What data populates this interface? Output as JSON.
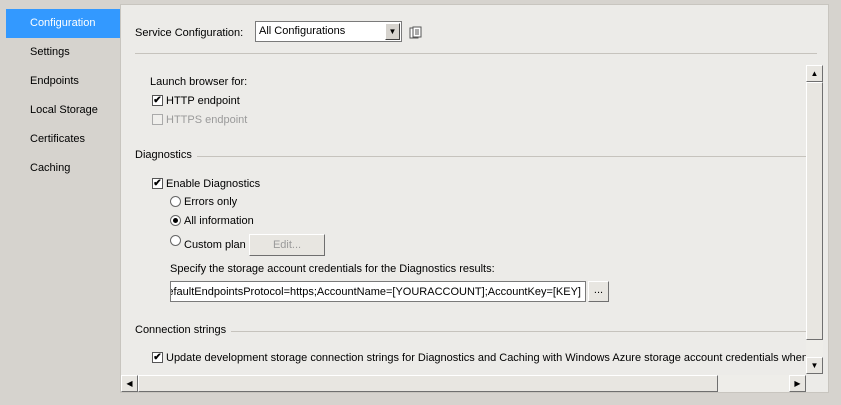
{
  "sidebar": {
    "items": [
      {
        "label": "Configuration",
        "selected": true
      },
      {
        "label": "Settings"
      },
      {
        "label": "Endpoints"
      },
      {
        "label": "Local Storage"
      },
      {
        "label": "Certificates"
      },
      {
        "label": "Caching"
      }
    ]
  },
  "service_configuration": {
    "label": "Service Configuration:",
    "selected_value": "All Configurations"
  },
  "launch_browser": {
    "label": "Launch browser for:",
    "http": {
      "label": "HTTP endpoint",
      "checked": true
    },
    "https": {
      "label": "HTTPS endpoint",
      "checked": false,
      "disabled": true
    }
  },
  "diagnostics": {
    "section_label": "Diagnostics",
    "enable": {
      "label": "Enable Diagnostics",
      "checked": true
    },
    "errors_only": {
      "label": "Errors only"
    },
    "all_information": {
      "label": "All information",
      "selected": true
    },
    "custom_plan": {
      "label": "Custom plan"
    },
    "edit_button": "Edit...",
    "credentials_label": "Specify the storage account credentials for the Diagnostics results:",
    "credentials_value": "DefaultEndpointsProtocol=https;AccountName=[YOURACCOUNT];AccountKey=[KEY]",
    "browse_button": "..."
  },
  "connection_strings": {
    "section_label": "Connection strings",
    "update_checkbox": {
      "label": "Update development storage connection strings for Diagnostics and Caching with Windows Azure storage account credentials when p",
      "checked": true
    }
  },
  "icons": {
    "vscroll_up": "▲",
    "vscroll_down": "▼",
    "hscroll_left": "◀",
    "hscroll_right": "▶",
    "dropdown": "▼",
    "checkmark": "✔"
  }
}
